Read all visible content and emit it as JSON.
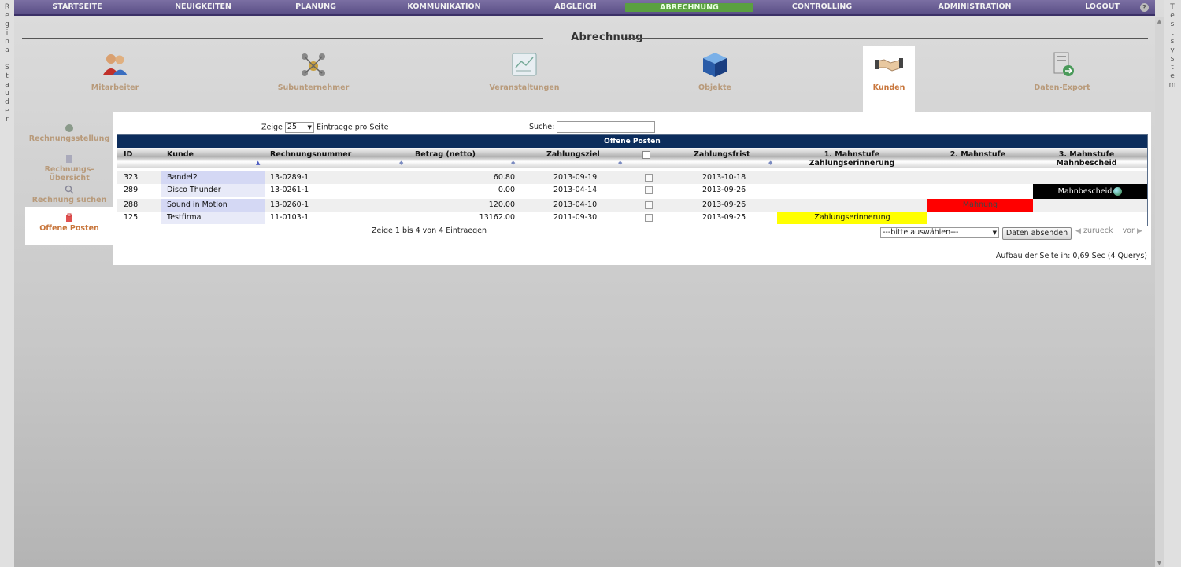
{
  "side_left_text": [
    "R",
    "e",
    "g",
    "i",
    "n",
    "a",
    "",
    "S",
    "t",
    "a",
    "u",
    "d",
    "e",
    "r"
  ],
  "side_right_text": [
    "T",
    "e",
    "s",
    "t",
    "s",
    "y",
    "s",
    "t",
    "e",
    "m"
  ],
  "nav": [
    {
      "label": "STARTSEITE"
    },
    {
      "label": "NEUIGKEITEN"
    },
    {
      "label": "PLANUNG"
    },
    {
      "label": "KOMMUNIKATION"
    },
    {
      "label": "ABGLEICH"
    },
    {
      "label": "ABRECHNUNG"
    },
    {
      "label": "CONTROLLING"
    },
    {
      "label": "ADMINISTRATION"
    },
    {
      "label": "LOGOUT"
    }
  ],
  "nav_help": "?",
  "page_title": "Abrechnung",
  "modules": [
    {
      "label": "Mitarbeiter",
      "icon": "people-icon"
    },
    {
      "label": "Subunternehmer",
      "icon": "network-users-icon"
    },
    {
      "label": "Veranstaltungen",
      "icon": "diagram-icon"
    },
    {
      "label": "Objekte",
      "icon": "cube-icon"
    },
    {
      "label": "Kunden",
      "icon": "handshake-icon"
    },
    {
      "label": "Daten-Export",
      "icon": "export-icon"
    }
  ],
  "submenu": [
    {
      "label": "Rechnungsstellung"
    },
    {
      "label": "Rechnungs-Übersicht"
    },
    {
      "label": "Rechnung suchen"
    },
    {
      "label": "Offene Posten"
    }
  ],
  "controls": {
    "show_prefix": "Zeige",
    "show_value": "25",
    "show_suffix": "Eintraege pro Seite",
    "search_label": "Suche:",
    "search_value": ""
  },
  "table": {
    "caption": "Offene Posten",
    "headers": {
      "id": "ID",
      "kunde": "Kunde",
      "rechnungsnummer": "Rechnungsnummer",
      "betrag": "Betrag (netto)",
      "zahlungsziel": "Zahlungsziel",
      "zahlungsfrist": "Zahlungsfrist",
      "mahn1": "1. Mahnstufe",
      "mahn1_sub": "Zahlungserinnerung",
      "mahn2": "2. Mahnstufe",
      "mahn3": "3. Mahnstufe",
      "mahn3_sub": "Mahnbescheid"
    },
    "rows": [
      {
        "id": "323",
        "kunde": "Bandel2",
        "nr": "13-0289-1",
        "betrag": "60.80",
        "ziel": "2013-09-19",
        "frist": "2013-10-18",
        "m1": "",
        "m2": "",
        "m3": ""
      },
      {
        "id": "289",
        "kunde": "Disco Thunder",
        "nr": "13-0261-1",
        "betrag": "0.00",
        "ziel": "2013-04-14",
        "frist": "2013-09-26",
        "m1": "",
        "m2": "",
        "m3": "Mahnbescheid"
      },
      {
        "id": "288",
        "kunde": "Sound in Motion",
        "nr": "13-0260-1",
        "betrag": "120.00",
        "ziel": "2013-04-10",
        "frist": "2013-09-26",
        "m1": "",
        "m2": "Mahnung",
        "m3": ""
      },
      {
        "id": "125",
        "kunde": "Testfirma",
        "nr": "11-0103-1",
        "betrag": "13162.00",
        "ziel": "2011-09-30",
        "frist": "2013-09-25",
        "m1": "Zahlungserinnerung",
        "m2": "",
        "m3": ""
      }
    ]
  },
  "footer": {
    "info": "Zeige 1 bis 4 von 4 Eintraegen",
    "select_value": "---bitte auswählen---",
    "submit": "Daten absenden",
    "prev": "zurueck",
    "next": "vor",
    "build_time": "Aufbau der Seite in: 0,69 Sec (4 Querys)"
  },
  "colors": {
    "nav_bg": "#5a4f86",
    "nav_active": "#5aa040",
    "caption_bg": "#0c2d5c",
    "stage1": "#ffff00",
    "stage2": "#ff0000",
    "stage3": "#000000"
  }
}
